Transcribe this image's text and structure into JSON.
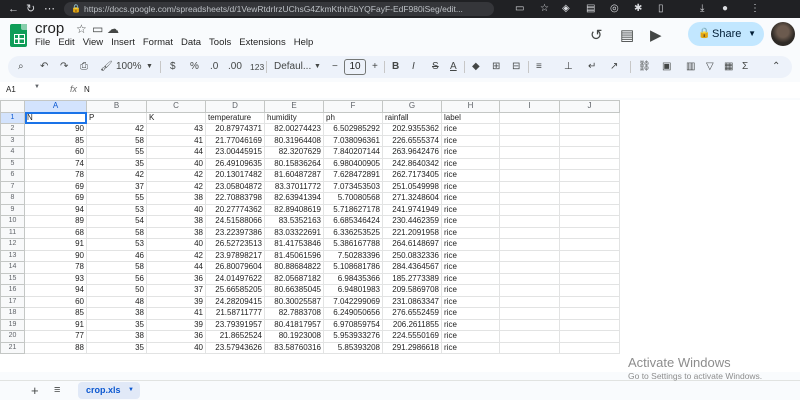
{
  "browser": {
    "url": "https://docs.google.com/spreadsheets/d/1VewRtdrlrzUChsG4ZkmKthh5bYQFayF-EdF980iSeg/edit..."
  },
  "doc": {
    "title": "crop"
  },
  "menu": [
    "File",
    "Edit",
    "View",
    "Insert",
    "Format",
    "Data",
    "Tools",
    "Extensions",
    "Help"
  ],
  "share": {
    "label": "Share"
  },
  "toolbar": {
    "zoom": "100%",
    "currency": "$",
    "percent": "%",
    "dec_dec": ".0",
    "inc_dec": ".00",
    "number_fmt": "123",
    "font": "Defaul...",
    "font_size": "10",
    "bold": "B",
    "italic": "I",
    "strike": "S",
    "text_color": "A",
    "functions": "Σ"
  },
  "formula_bar": {
    "cell_ref": "A1",
    "fx": "fx",
    "content": "N"
  },
  "columns": [
    "A",
    "B",
    "C",
    "D",
    "E",
    "F",
    "G",
    "H",
    "I",
    "J"
  ],
  "header_row": [
    "N",
    "P",
    "K",
    "temperature",
    "humidity",
    "ph",
    "rainfall",
    "label",
    "",
    ""
  ],
  "rows": [
    [
      "90",
      "42",
      "43",
      "20.87974371",
      "82.00274423",
      "6.502985292",
      "202.9355362",
      "rice"
    ],
    [
      "85",
      "58",
      "41",
      "21.77046169",
      "80.31964408",
      "7.038096361",
      "226.6555374",
      "rice"
    ],
    [
      "60",
      "55",
      "44",
      "23.00445915",
      "82.3207629",
      "7.840207144",
      "263.9642476",
      "rice"
    ],
    [
      "74",
      "35",
      "40",
      "26.49109635",
      "80.15836264",
      "6.980400905",
      "242.8640342",
      "rice"
    ],
    [
      "78",
      "42",
      "42",
      "20.13017482",
      "81.60487287",
      "7.628472891",
      "262.7173405",
      "rice"
    ],
    [
      "69",
      "37",
      "42",
      "23.05804872",
      "83.37011772",
      "7.073453503",
      "251.0549998",
      "rice"
    ],
    [
      "69",
      "55",
      "38",
      "22.70883798",
      "82.63941394",
      "5.70080568",
      "271.3248604",
      "rice"
    ],
    [
      "94",
      "53",
      "40",
      "20.27774362",
      "82.89408619",
      "5.718627178",
      "241.9741949",
      "rice"
    ],
    [
      "89",
      "54",
      "38",
      "24.51588066",
      "83.5352163",
      "6.685346424",
      "230.4462359",
      "rice"
    ],
    [
      "68",
      "58",
      "38",
      "23.22397386",
      "83.03322691",
      "6.336253525",
      "221.2091958",
      "rice"
    ],
    [
      "91",
      "53",
      "40",
      "26.52723513",
      "81.41753846",
      "5.386167788",
      "264.6148697",
      "rice"
    ],
    [
      "90",
      "46",
      "42",
      "23.97898217",
      "81.45061596",
      "7.50283396",
      "250.0832336",
      "rice"
    ],
    [
      "78",
      "58",
      "44",
      "26.80079604",
      "80.88684822",
      "5.108681786",
      "284.4364567",
      "rice"
    ],
    [
      "93",
      "56",
      "36",
      "24.01497622",
      "82.05687182",
      "6.98435366",
      "185.2773389",
      "rice"
    ],
    [
      "94",
      "50",
      "37",
      "25.66585205",
      "80.66385045",
      "6.94801983",
      "209.5869708",
      "rice"
    ],
    [
      "60",
      "48",
      "39",
      "24.28209415",
      "80.30025587",
      "7.042299069",
      "231.0863347",
      "rice"
    ],
    [
      "85",
      "38",
      "41",
      "21.58711777",
      "82.7883708",
      "6.249050656",
      "276.6552459",
      "rice"
    ],
    [
      "91",
      "35",
      "39",
      "23.79391957",
      "80.41817957",
      "6.970859754",
      "206.2611855",
      "rice"
    ],
    [
      "77",
      "38",
      "36",
      "21.8652524",
      "80.1923008",
      "5.953933276",
      "224.5550169",
      "rice"
    ],
    [
      "88",
      "35",
      "40",
      "23.57943626",
      "83.58760316",
      "5.85393208",
      "291.2986618",
      "rice"
    ]
  ],
  "sheet_tab": {
    "name": "crop.xls"
  },
  "watermark": {
    "title": "Activate Windows",
    "subtitle": "Go to Settings to activate Windows."
  }
}
